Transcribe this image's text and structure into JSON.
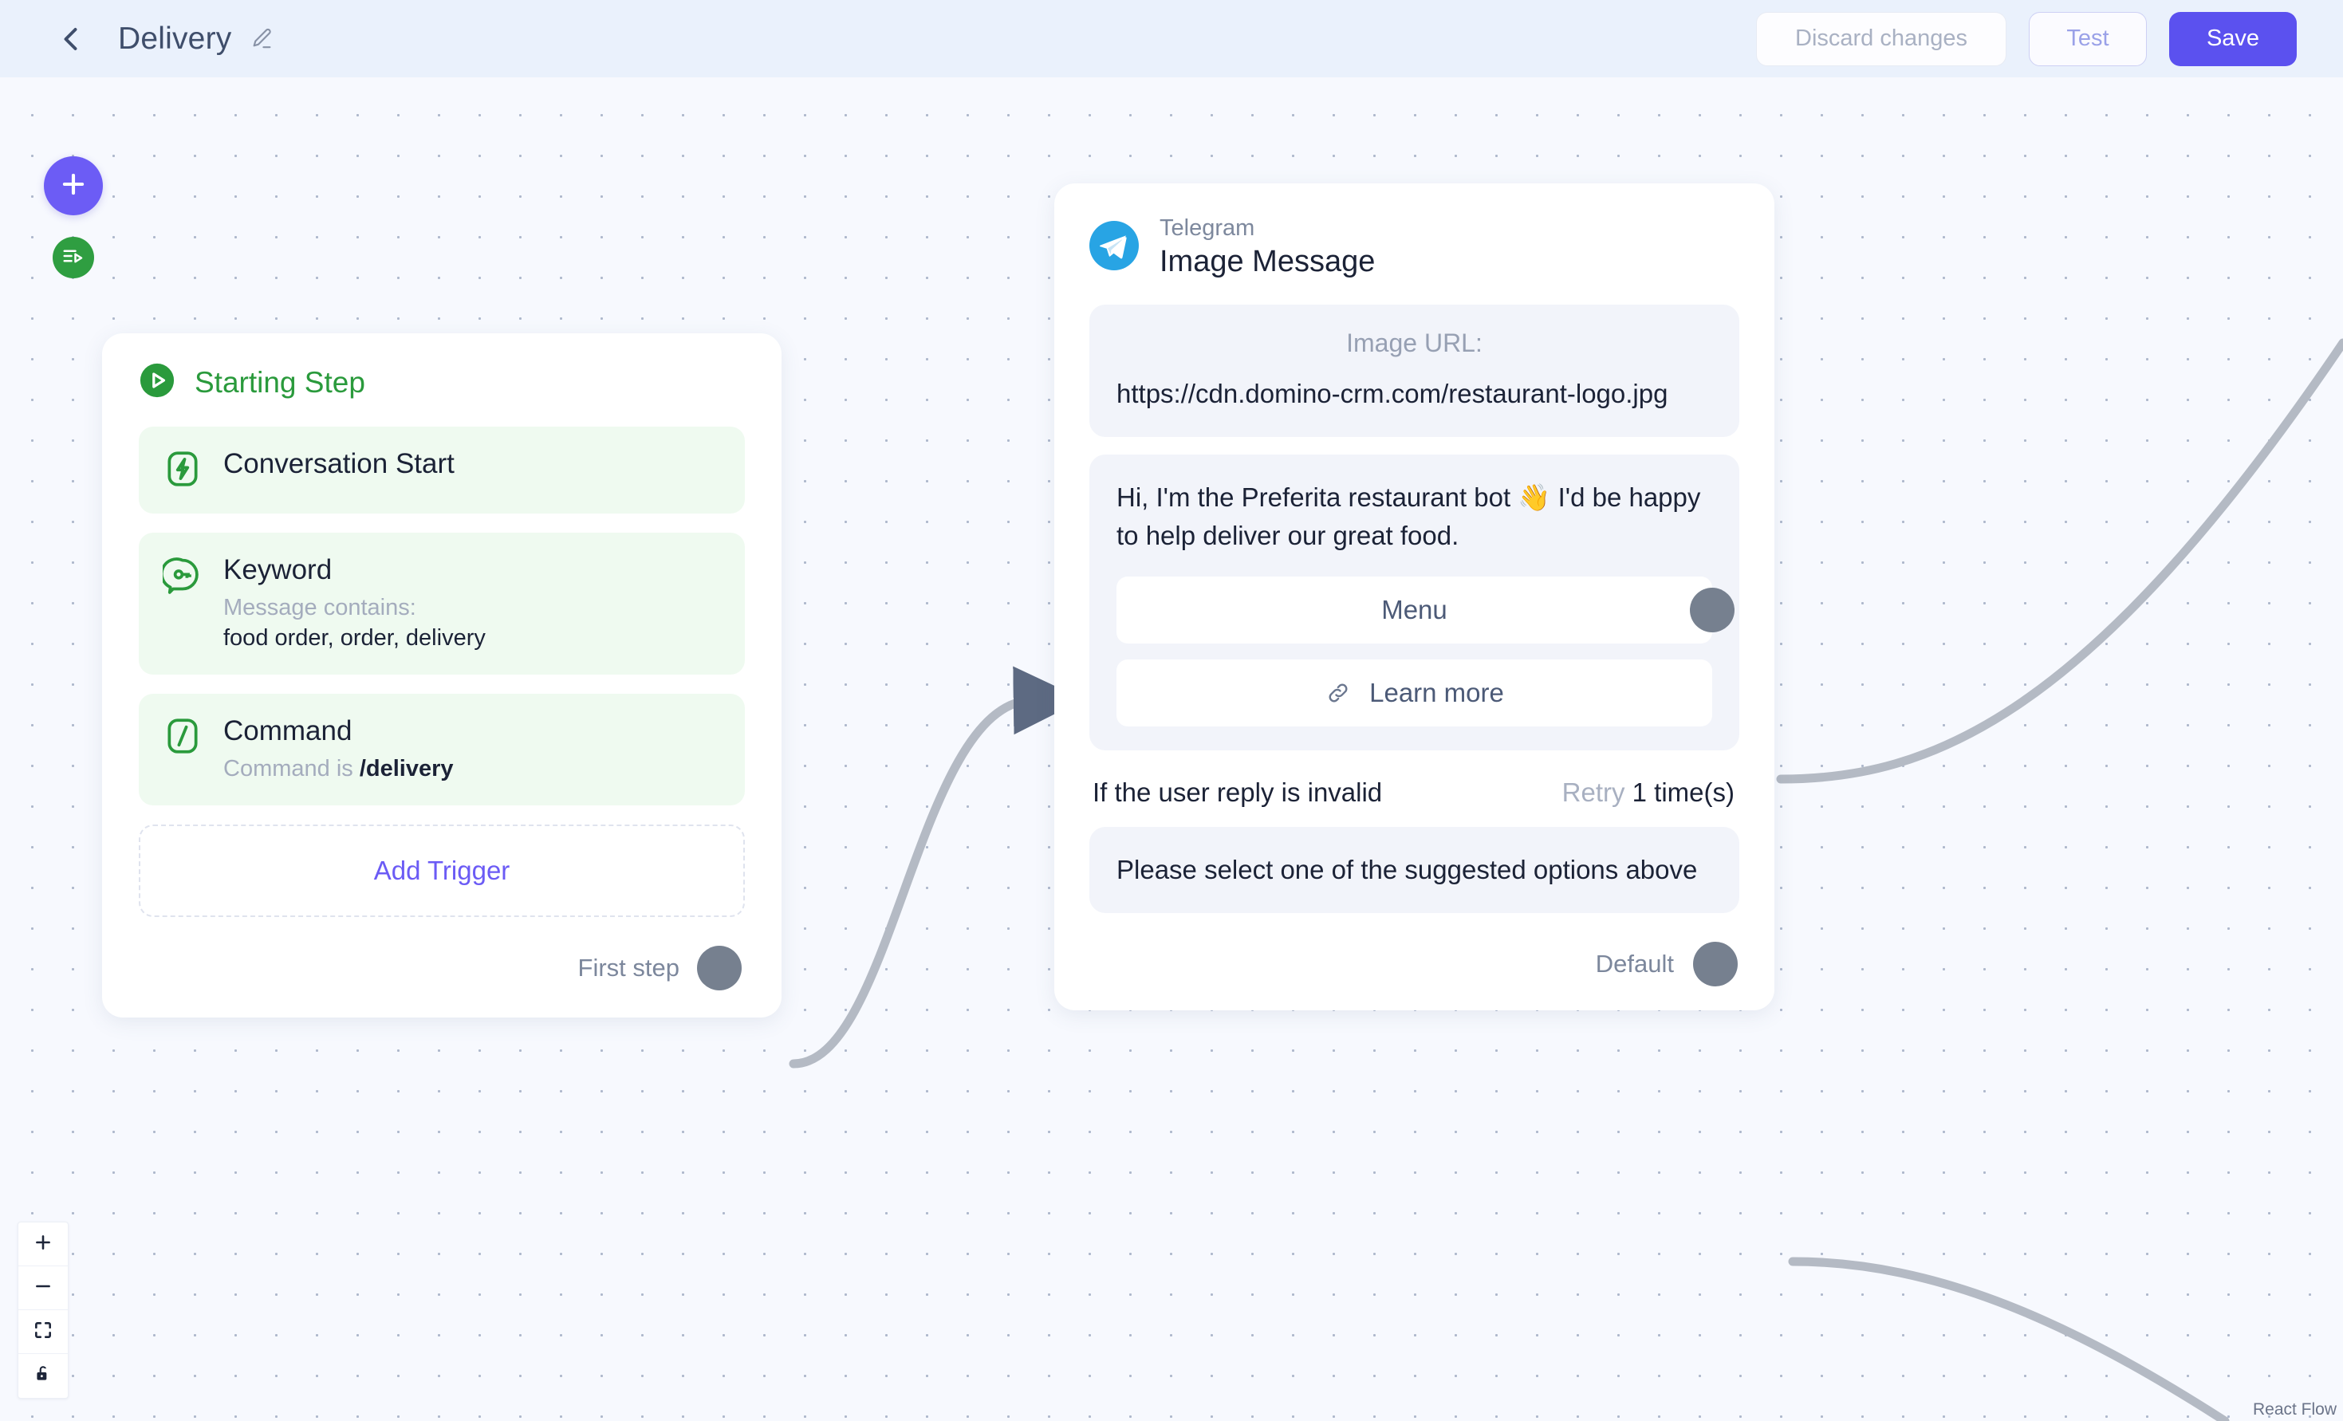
{
  "header": {
    "back_icon": "chevron-left-icon",
    "title": "Delivery",
    "edit_icon": "pencil-edit-icon",
    "discard_label": "Discard changes",
    "test_label": "Test",
    "save_label": "Save",
    "bg_color": "#eaf1fc",
    "accent_color": "#5b51ef"
  },
  "toolbar": {
    "add_node_icon": "plus-icon",
    "flows_icon": "flow-list-play-icon",
    "add_node_color": "#6c5cf5",
    "flows_color": "#2f9e41"
  },
  "zoom_controls": {
    "zoom_in_icon": "plus-icon",
    "zoom_out_icon": "minus-icon",
    "fit_view_icon": "fit-view-icon",
    "lock_icon": "unlock-icon"
  },
  "attribution": {
    "label": "React Flow"
  },
  "start_node": {
    "icon": "play-circle-icon",
    "title": "Starting Step",
    "title_color": "#2a9a3c",
    "triggers": [
      {
        "icon": "lightning-bolt-icon",
        "title": "Conversation Start",
        "sub_label": "",
        "value": ""
      },
      {
        "icon": "keyword-speech-bubble-icon",
        "title": "Keyword",
        "sub_label": "Message contains:",
        "value": "food order, order, delivery"
      },
      {
        "icon": "slash-command-icon",
        "title": "Command",
        "sub_label": "Command is",
        "value": "/delivery"
      }
    ],
    "add_trigger_label": "Add Trigger",
    "add_trigger_color": "#6b5bf5",
    "output_label": "First step"
  },
  "telegram_node": {
    "logo_icon": "telegram-icon",
    "logo_color": "#28a4e4",
    "channel": "Telegram",
    "type": "Image Message",
    "image_url_label": "Image URL:",
    "image_url_value": "https://cdn.domino-crm.com/restaurant-logo.jpg",
    "message_text": "Hi, I'm the Preferita restaurant bot 👋 I'd be happy to help deliver our great food.",
    "reply_buttons": [
      {
        "label": "Menu",
        "icon": "",
        "has_handle": true
      },
      {
        "label": "Learn more",
        "icon": "link-chain-icon",
        "has_handle": false
      }
    ],
    "retry_label": "If the user reply is invalid",
    "retry_prefix": "Retry",
    "retry_value": "1 time(s)",
    "fallback_text": "Please select one of the suggested options above",
    "output_label": "Default"
  },
  "edges": {
    "color": "#b4bac4",
    "handle_color": "#76808f"
  }
}
